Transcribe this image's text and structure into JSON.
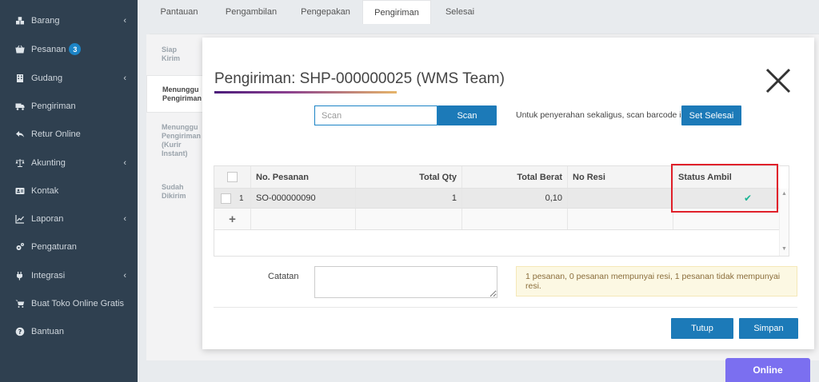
{
  "sidebar": {
    "items": [
      {
        "label": "Barang",
        "icon": "cubes-icon",
        "chevron": "‹"
      },
      {
        "label": "Pesanan",
        "icon": "basket-icon",
        "badge": "3"
      },
      {
        "label": "Gudang",
        "icon": "building-icon",
        "chevron": "‹"
      },
      {
        "label": "Pengiriman",
        "icon": "truck-icon"
      },
      {
        "label": "Retur Online",
        "icon": "reply-icon"
      },
      {
        "label": "Akunting",
        "icon": "balance-scale-icon",
        "chevron": "‹"
      },
      {
        "label": "Kontak",
        "icon": "contact-card-icon"
      },
      {
        "label": "Laporan",
        "icon": "line-chart-icon",
        "chevron": "‹"
      },
      {
        "label": "Pengaturan",
        "icon": "cogs-icon"
      },
      {
        "label": "Integrasi",
        "icon": "plug-icon",
        "chevron": "‹"
      },
      {
        "label": "Buat Toko Online Gratis",
        "icon": "cart-icon"
      },
      {
        "label": "Bantuan",
        "icon": "question-circle-icon"
      }
    ]
  },
  "tabs": [
    "Pantauan",
    "Pengambilan",
    "Pengepakan",
    "Pengiriman",
    "Selesai"
  ],
  "active_tab": "Pengiriman",
  "steps": [
    {
      "lines": [
        "Siap",
        "Kirim"
      ]
    },
    {
      "lines": [
        "Menunggu",
        "Pengiriman"
      ],
      "active": true
    },
    {
      "lines": [
        "Menunggu",
        "Pengiriman",
        "(Kurir",
        "Instant)"
      ]
    },
    {
      "lines": [
        "Sudah",
        "Dikirim"
      ]
    }
  ],
  "modal": {
    "title": "Pengiriman: SHP-000000025 (WMS Team)",
    "scan_placeholder": "Scan",
    "scan_button": "Scan",
    "hint": "Untuk penyerahan sekaligus, scan barcode ini",
    "set_selesai_button": "Set Selesai",
    "grid": {
      "headers": {
        "no_pesanan": "No. Pesanan",
        "total_qty": "Total Qty",
        "total_berat": "Total Berat",
        "no_resi": "No Resi",
        "status_ambil": "Status Ambil"
      },
      "rows": [
        {
          "index": "1",
          "no_pesanan": "SO-000000090",
          "total_qty": "1",
          "total_berat": "0,10",
          "no_resi": "",
          "status_ambil": "✔"
        }
      ],
      "add_row": "+"
    },
    "catatan_label": "Catatan",
    "info": "1 pesanan, 0 pesanan mempunyai resi, 1 pesanan tidak mempunyai resi.",
    "tutup_button": "Tutup",
    "simpan_button": "Simpan"
  },
  "online_button": "Online",
  "colors": {
    "sidebar_bg": "#2f4050",
    "primary": "#1c7ab8",
    "badge": "#1c84c6",
    "check": "#1ab394",
    "highlight": "#e0202a",
    "online": "#7b6ff0"
  }
}
